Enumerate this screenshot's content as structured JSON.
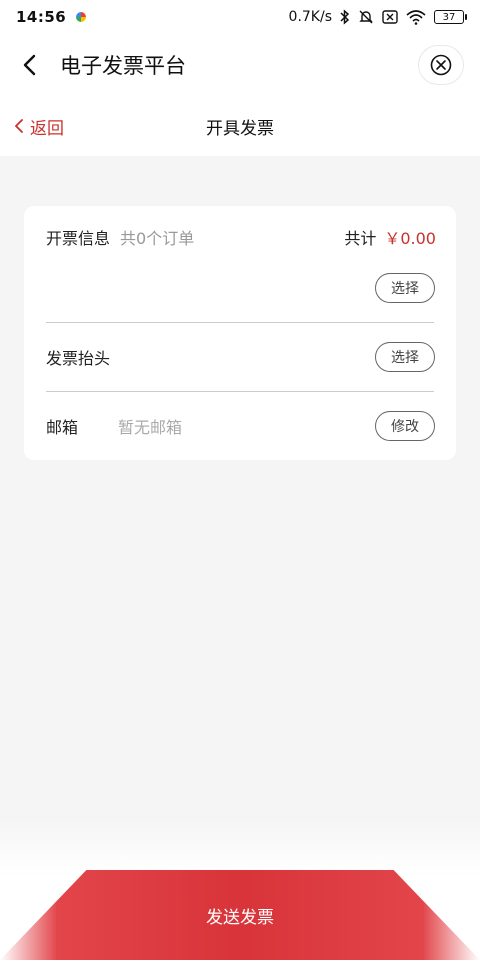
{
  "status_bar": {
    "time": "14:56",
    "network_speed": "0.7K/s",
    "battery_level": "37",
    "icons": [
      "bluetooth-icon",
      "mute-icon",
      "sim-icon",
      "wifi-icon",
      "battery-icon"
    ]
  },
  "app_bar": {
    "title": "电子发票平台",
    "back_icon": "chevron-left-icon",
    "close_icon": "close-circle-icon"
  },
  "sub_header": {
    "back_label": "返回",
    "title": "开具发票"
  },
  "invoice_card": {
    "info_label": "开票信息",
    "order_count": "共0个订单",
    "total_label": "共计",
    "total_amount": "￥0.00",
    "select_orders_label": "选择",
    "header_label": "发票抬头",
    "select_header_label": "选择",
    "email_label": "邮箱",
    "email_placeholder": "暂无邮箱",
    "edit_email_label": "修改"
  },
  "footer": {
    "send_label": "发送发票"
  },
  "colors": {
    "accent": "#c8322d",
    "button": "#d8343a"
  }
}
